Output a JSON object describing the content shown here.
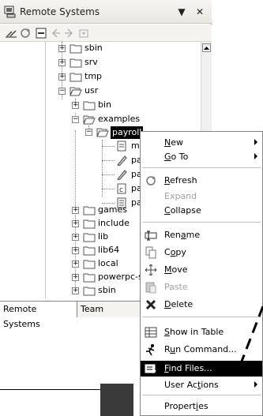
{
  "view": {
    "title": "Remote Systems",
    "title_menu_glyph": "▼",
    "title_close_glyph": "✕",
    "toolbar": {
      "icons": [
        "connect-icon",
        "refresh-icon",
        "collapse-all-icon",
        "back-icon",
        "forward-icon",
        "home-icon"
      ]
    },
    "tree": {
      "sbin": "sbin",
      "srv": "srv",
      "tmp": "tmp",
      "usr": "usr",
      "bin": "bin",
      "examples": "examples",
      "payroll": "payroll",
      "file1": "m",
      "file2": "pa",
      "file3": "pa",
      "file4": "pa",
      "file5": "pa",
      "games": "games",
      "include": "include",
      "lib": "lib",
      "lib64": "lib64",
      "local": "local",
      "powerpc": "powerpc-s",
      "sbin2": "sbin"
    },
    "expander_plus": "+",
    "expander_minus": "−",
    "tabs": [
      "Remote Systems",
      "Team"
    ]
  },
  "menu": {
    "new": {
      "pre": "",
      "u": "N",
      "post": "ew"
    },
    "goto": {
      "pre": "",
      "u": "G",
      "post": "o To"
    },
    "refresh": {
      "pre": "",
      "u": "R",
      "post": "efresh"
    },
    "expand": "Expand",
    "collapse": {
      "pre": "",
      "u": "C",
      "post": "ollapse"
    },
    "rename": {
      "pre": "Ren",
      "u": "a",
      "post": "me"
    },
    "copy": {
      "pre": "C",
      "u": "o",
      "post": "py"
    },
    "move": {
      "pre": "",
      "u": "M",
      "post": "ove"
    },
    "paste": "Paste",
    "delete": {
      "pre": "",
      "u": "D",
      "post": "elete"
    },
    "show_in_table": {
      "pre": "",
      "u": "S",
      "post": "how in Table"
    },
    "run_command": {
      "pre": "R",
      "u": "u",
      "post": "n Command..."
    },
    "find_files": {
      "pre": "",
      "u": "F",
      "post": "ind Files..."
    },
    "user_actions": {
      "pre": "User Ac",
      "u": "t",
      "post": "ions"
    },
    "properties": {
      "pre": "Propert",
      "u": "i",
      "post": "es"
    }
  },
  "colors": {
    "highlight": "#000000",
    "disabled_text": "#a0a0a0",
    "folder_fill": "#ffffff",
    "callout": "#000000"
  }
}
